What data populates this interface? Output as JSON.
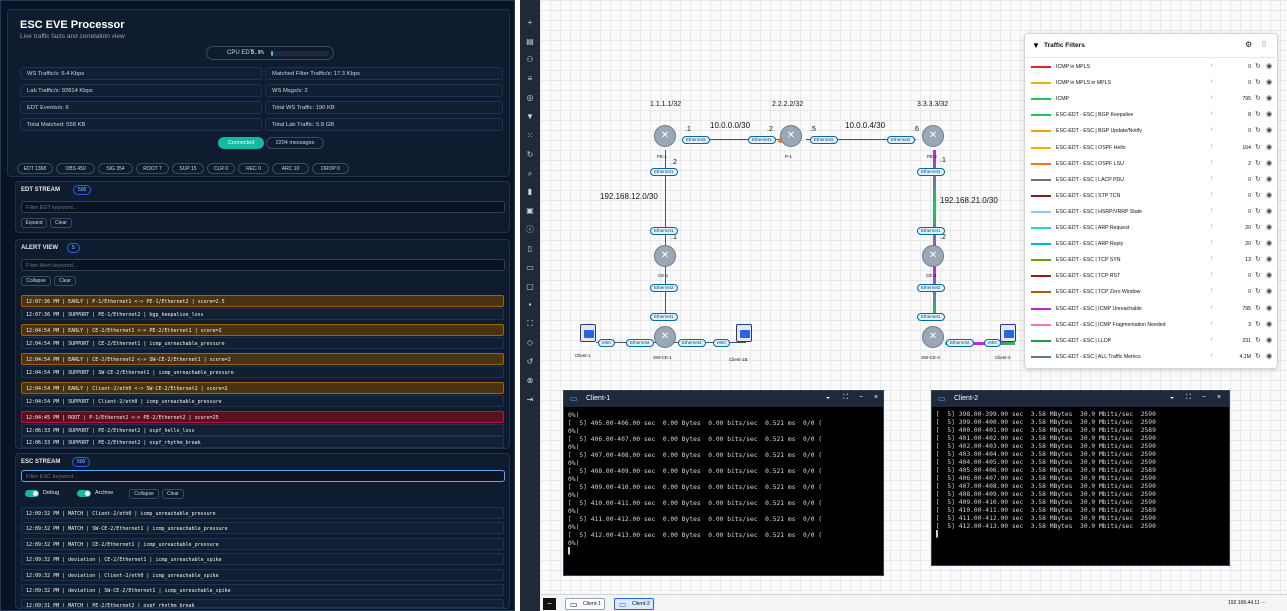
{
  "app": {
    "title": "ESC EVE Processor",
    "subtitle": "Live traffic facts and correlation view"
  },
  "cpu": {
    "label": "CPU EDT",
    "value": "3.9%",
    "fraction": 0.039
  },
  "stats": [
    "WS Traffic/s: 6.4 Kbps",
    "Matched Filter Traffic/s: 17.3 Kbps",
    "Lab Traffic/s: 92814 Kbps",
    "WS Msgs/s: 2",
    "EDT Events/s: 6",
    "Total WS Traffic: 190 KB",
    "Total Matched: 558 KB",
    "Total Lab Traffic: 5.8 GB"
  ],
  "status": {
    "connected": "Connected",
    "messages": "2204 messages"
  },
  "chips": [
    "EDT 1368",
    "OBS 450",
    "SIG 354",
    "ROOT 7",
    "SUP 15",
    "CLR 0",
    "REC 0",
    "ARC 10",
    "DROP 0"
  ],
  "edt": {
    "title": "EDT STREAM",
    "count": "500",
    "placeholder": "Filter EDT keyword...",
    "expand": "Expand",
    "clear": "Clear"
  },
  "alert": {
    "title": "ALERT VIEW",
    "count": "5",
    "placeholder": "Filter Alert keyword...",
    "collapse": "Collapse",
    "clear": "Clear",
    "rows": [
      "12:07:36 PM | EARLY | P-1/Ethernet1 <-> PE-1/Ethernet2 | score=2.5",
      "12:07:36 PM | SUPPORT | PE-1/Ethernet2 | bgp_keepalive_loss",
      "12:04:54 PM | EARLY | CE-2/Ethernet1 <-> PE-2/Ethernet1 | score=2",
      "12:04:54 PM | SUPPORT | CE-2/Ethernet1 | icmp_unreachable_pressure",
      "12:04:54 PM | EARLY | CE-2/Ethernet2 <-> SW-CE-2/Ethernet1 | score=2",
      "12:04:54 PM | SUPPORT | SW-CE-2/Ethernet1 | icmp_unreachable_pressure",
      "12:04:54 PM | EARLY | Client-2/eth0 <-> SW-CE-2/Ethernet2 | score=2",
      "12:04:54 PM | SUPPORT | Client-2/eth0 | icmp_unreachable_pressure",
      "12:04:45 PM | ROOT | P-1/Ethernet2 <-> PE-2/Ethernet2 | score=25",
      "12:06:33 PM | SUPPORT | PE-2/Ethernet2 | ospf_hello_loss",
      "12:06:33 PM | SUPPORT | PE-2/Ethernet2 | ospf_rhythm_break"
    ]
  },
  "esc": {
    "title": "ESC STREAM",
    "count": "500",
    "placeholder": "Filter ESC keyword...",
    "debug": "Debug",
    "archive": "Archive",
    "collapse": "Collapse",
    "clear": "Clear",
    "rows": [
      "12:09:32 PM | MATCH | Client-2/eth0 | icmp_unreachable_pressure",
      "12:09:32 PM | MATCH | SW-CE-2/Ethernet1 | icmp_unreachable_pressure",
      "12:09:32 PM | MATCH | CE-2/Ethernet1 | icmp_unreachable_pressure",
      "12:09:32 PM | deviation | CE-2/Ethernet1 | icmp_unreachable_spike",
      "12:09:32 PM | deviation | Client-2/eth0 | icmp_unreachable_spike",
      "12:09:32 PM | deviation | SW-CE-2/Ethernet1 | icmp_unreachable_spike",
      "12:09:31 PM | MATCH | PE-2/Ethernet2 | ospf_rhythm_break"
    ]
  },
  "topo": {
    "ips": {
      "pe1": "1.1.1.1/32",
      "p1": "2.2.2.2/32",
      "pe2": "3.3.3.3/32"
    },
    "nets": [
      "10.0.0.0/30",
      "10.0.0.4/30",
      "192.168.12.0/30",
      "192.168.21.0/30"
    ],
    "hosts": [
      ".1",
      ".2",
      ".5",
      ".6",
      ".2",
      ".1",
      ".1",
      ".2"
    ],
    "nodes": [
      "PE-1",
      "P-1",
      "PE-2",
      "CE-1",
      "CE-2",
      "SW-CE-1",
      "SW-CE-2",
      "Client-1",
      "Client-1B",
      "Client-2"
    ],
    "ports": {
      "eth1": "Ethernet1",
      "eth2": "Ethernet2",
      "eth3": "Ethernet3",
      "eth0": "eth0"
    }
  },
  "filters": {
    "title": "Traffic Filters",
    "items": [
      {
        "name": "ICMP in MPLS",
        "color": "#dc2626",
        "count": "0"
      },
      {
        "name": "ICMP in MPLS in MPLS",
        "color": "#eab308",
        "count": "0"
      },
      {
        "name": "ICMP",
        "color": "#22c55e",
        "count": "795"
      },
      {
        "name": "ESC-EDT - ESC | BGP Keepalive",
        "color": "#22c55e",
        "count": "8"
      },
      {
        "name": "ESC-EDT - ESC | BGP Update/Notify",
        "color": "#f59e0b",
        "count": "0"
      },
      {
        "name": "ESC-EDT - ESC | OSPF Hello",
        "color": "#eab308",
        "count": "164"
      },
      {
        "name": "ESC-EDT - ESC | OSPF LSU",
        "color": "#f97316",
        "count": "2"
      },
      {
        "name": "ESC-EDT - ESC | LACP PDU",
        "color": "#6b7280",
        "count": "0"
      },
      {
        "name": "ESC-EDT - ESC | STP TCN",
        "color": "#7f1d1d",
        "count": "0"
      },
      {
        "name": "ESC-EDT - ESC | HSRP/VRRP State",
        "color": "#93c5fd",
        "count": "0"
      },
      {
        "name": "ESC-EDT - ESC | ARP Request",
        "color": "#2dd4bf",
        "count": "20"
      },
      {
        "name": "ESC-EDT - ESC | ARP Reply",
        "color": "#06b6d4",
        "count": "20"
      },
      {
        "name": "ESC-EDT - ESC | TCP SYN",
        "color": "#65a30d",
        "count": "13"
      },
      {
        "name": "ESC-EDT - ESC | TCP RST",
        "color": "#991b1b",
        "count": "0"
      },
      {
        "name": "ESC-EDT - ESC | TCP Zero Window",
        "color": "#a16207",
        "count": "0"
      },
      {
        "name": "ESC-EDT - ESC | ICMP Unreachable",
        "color": "#c026d3",
        "count": "795"
      },
      {
        "name": "ESC-EDT - ESC | ICMP Fragmentation Needed",
        "color": "#f472b6",
        "count": "3"
      },
      {
        "name": "ESC-EDT - ESC | LLDP",
        "color": "#16a34a",
        "count": "231"
      },
      {
        "name": "ESC-EDT - ESC | ALL Traffic Metrics",
        "color": "#64748b",
        "count": "4.1M"
      }
    ]
  },
  "term1": {
    "title": "Client-1",
    "lines": [
      "0%)",
      "[  5] 405.00-406.00 sec  0.00 Bytes  0.00 bits/sec  0.521 ms  0/0 (",
      "0%)",
      "[  5] 406.00-407.00 sec  0.00 Bytes  0.00 bits/sec  0.521 ms  0/0 (",
      "0%)",
      "[  5] 407.00-408.00 sec  0.00 Bytes  0.00 bits/sec  0.521 ms  0/0 (",
      "0%)",
      "[  5] 408.00-409.00 sec  0.00 Bytes  0.00 bits/sec  0.521 ms  0/0 (",
      "0%)",
      "[  5] 409.00-410.00 sec  0.00 Bytes  0.00 bits/sec  0.521 ms  0/0 (",
      "0%)",
      "[  5] 410.00-411.00 sec  0.00 Bytes  0.00 bits/sec  0.521 ms  0/0 (",
      "0%)",
      "[  5] 411.00-412.00 sec  0.00 Bytes  0.00 bits/sec  0.521 ms  0/0 (",
      "0%)",
      "[  5] 412.00-413.00 sec  0.00 Bytes  0.00 bits/sec  0.521 ms  0/0 (",
      "0%)",
      "▌"
    ]
  },
  "term2": {
    "title": "Client-2",
    "lines": [
      "[  5] 398.00-399.00 sec  3.58 MBytes  30.0 Mbits/sec  2590",
      "[  5] 399.00-400.00 sec  3.58 MBytes  30.0 Mbits/sec  2590",
      "[  5] 400.00-401.00 sec  3.58 MBytes  30.0 Mbits/sec  2589",
      "[  5] 401.00-402.00 sec  3.58 MBytes  30.0 Mbits/sec  2590",
      "[  5] 402.00-403.00 sec  3.58 MBytes  30.0 Mbits/sec  2590",
      "[  5] 403.00-404.00 sec  3.58 MBytes  30.0 Mbits/sec  2590",
      "[  5] 404.00-405.00 sec  3.58 MBytes  30.0 Mbits/sec  2590",
      "[  5] 405.00-406.00 sec  3.58 MBytes  30.0 Mbits/sec  2589",
      "[  5] 406.00-407.00 sec  3.58 MBytes  30.0 Mbits/sec  2590",
      "[  5] 407.00-408.00 sec  3.58 MBytes  30.0 Mbits/sec  2590",
      "[  5] 408.00-409.00 sec  3.58 MBytes  30.0 Mbits/sec  2590",
      "[  5] 409.00-410.00 sec  3.58 MBytes  30.0 Mbits/sec  2590",
      "[  5] 410.00-411.00 sec  3.58 MBytes  30.0 Mbits/sec  2589",
      "[  5] 411.00-412.00 sec  3.58 MBytes  30.0 Mbits/sec  2590",
      "[  5] 412.00-413.00 sec  3.58 MBytes  30.0 Mbits/sec  2590",
      "▌"
    ]
  },
  "taskbar": {
    "items": [
      "Client-1",
      "Client-2"
    ],
    "ip": "192.168.44.11"
  }
}
